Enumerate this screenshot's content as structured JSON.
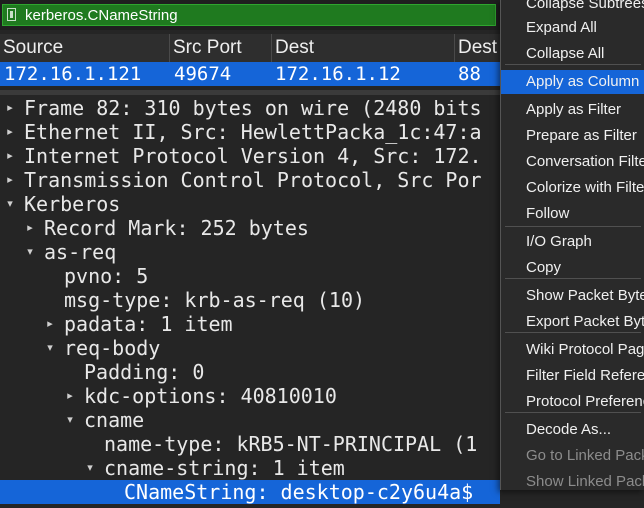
{
  "filter": {
    "text": "kerberos.CNameString"
  },
  "packet_list": {
    "columns": [
      "Source",
      "Src Port",
      "Dest",
      "Dest"
    ],
    "row": [
      "172.16.1.121",
      "49674",
      "172.16.1.12",
      "88"
    ]
  },
  "tree": [
    {
      "text": "Frame 82: 310 bytes on wire (2480 bits",
      "arrow": "collapsed"
    },
    {
      "text": "Ethernet II, Src: HewlettPacka_1c:47:a",
      "arrow": "collapsed"
    },
    {
      "text": "Internet Protocol Version 4, Src: 172.",
      "arrow": "collapsed"
    },
    {
      "text": "Transmission Control Protocol, Src Por",
      "arrow": "collapsed"
    },
    {
      "text": "Kerberos",
      "arrow": "expanded"
    },
    {
      "text": "Record Mark: 252 bytes",
      "arrow": "collapsed"
    },
    {
      "text": "as-req",
      "arrow": "expanded"
    },
    {
      "text": "pvno: 5",
      "arrow": "none"
    },
    {
      "text": "msg-type: krb-as-req (10)",
      "arrow": "none"
    },
    {
      "text": "padata: 1 item",
      "arrow": "collapsed"
    },
    {
      "text": "req-body",
      "arrow": "expanded"
    },
    {
      "text": "Padding: 0",
      "arrow": "none"
    },
    {
      "text": "kdc-options: 40810010",
      "arrow": "collapsed"
    },
    {
      "text": "cname",
      "arrow": "expanded"
    },
    {
      "text": "name-type: kRB5-NT-PRINCIPAL (1",
      "arrow": "none"
    },
    {
      "text": "cname-string: 1 item",
      "arrow": "expanded"
    },
    {
      "text": "CNameString: desktop-c2y6u4a$",
      "arrow": "none"
    }
  ],
  "context_menu": {
    "items": [
      {
        "label": "Collapse Subtrees",
        "state": "normal"
      },
      {
        "label": "Expand All",
        "state": "normal"
      },
      {
        "label": "Collapse All",
        "state": "normal"
      },
      {
        "label": "Apply as Column",
        "state": "highlighted"
      },
      {
        "label": "Apply as Filter",
        "state": "normal"
      },
      {
        "label": "Prepare as Filter",
        "state": "normal"
      },
      {
        "label": "Conversation Filter",
        "state": "normal"
      },
      {
        "label": "Colorize with Filter",
        "state": "normal"
      },
      {
        "label": "Follow",
        "state": "normal"
      },
      {
        "label": "I/O Graph",
        "state": "normal"
      },
      {
        "label": "Copy",
        "state": "normal"
      },
      {
        "label": "Show Packet Bytes...",
        "state": "normal"
      },
      {
        "label": "Export Packet Bytes...",
        "state": "normal"
      },
      {
        "label": "Wiki Protocol Page",
        "state": "normal"
      },
      {
        "label": "Filter Field Reference",
        "state": "normal"
      },
      {
        "label": "Protocol Preferences",
        "state": "normal"
      },
      {
        "label": "Decode As...",
        "state": "normal"
      },
      {
        "label": "Go to Linked Packet",
        "state": "disabled"
      },
      {
        "label": "Show Linked Packet",
        "state": "disabled"
      }
    ]
  },
  "colors": {
    "selection": "#1565d8",
    "filter_valid": "#1f7a1f",
    "background": "#252525"
  }
}
